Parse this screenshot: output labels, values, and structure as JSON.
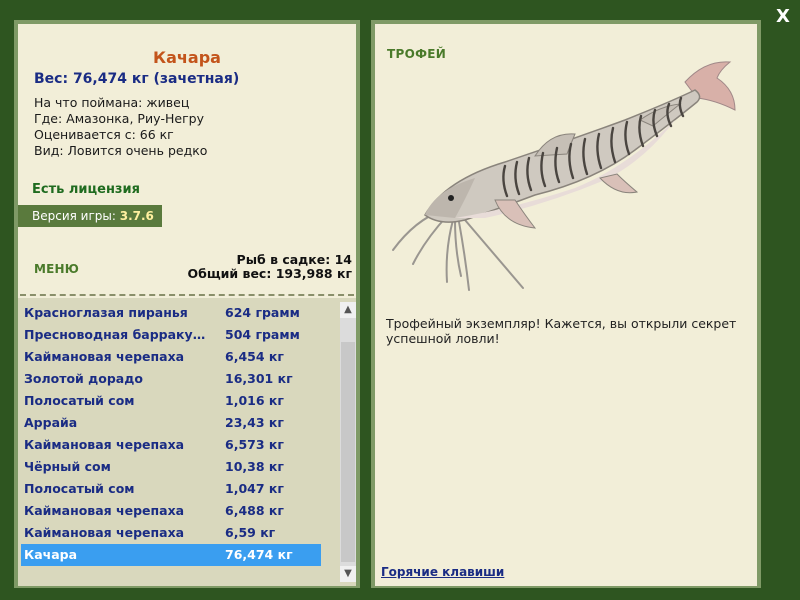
{
  "close_label": "X",
  "fish": {
    "name": "Качара",
    "weight_line": "Вес: 76,474 кг (зачетная)",
    "caught_with": "На что поймана: живец",
    "location": "Где: Амазонка, Риу-Негру",
    "valued_from": "Оценивается с: 66 кг",
    "kind": "Вид: Ловится очень редко"
  },
  "license": "Есть лицензия",
  "version": {
    "label": "Версия игры: ",
    "value": "3.7.6"
  },
  "menu_label": "МЕНЮ",
  "keepnet": {
    "count_line": "Рыб в садке: 14",
    "total_line": "Общий вес: 193,988 кг"
  },
  "catch_list": [
    {
      "name": "Красноглазая пиранья",
      "weight": "624 грамм"
    },
    {
      "name": "Пресноводная барраку…",
      "weight": "504 грамм"
    },
    {
      "name": "Каймановая черепаха",
      "weight": "6,454 кг"
    },
    {
      "name": "Золотой дорадо",
      "weight": "16,301 кг"
    },
    {
      "name": "Полосатый сом",
      "weight": "1,016 кг"
    },
    {
      "name": "Аррайа",
      "weight": "23,43 кг"
    },
    {
      "name": "Каймановая черепаха",
      "weight": "6,573 кг"
    },
    {
      "name": "Чёрный сом",
      "weight": "10,38 кг"
    },
    {
      "name": "Полосатый сом",
      "weight": "1,047 кг"
    },
    {
      "name": "Каймановая черепаха",
      "weight": "6,488 кг"
    },
    {
      "name": "Каймановая черепаха",
      "weight": "6,59 кг"
    },
    {
      "name": "Качара",
      "weight": "76,474 кг"
    }
  ],
  "selected_index": 11,
  "trophy": {
    "title": "ТРОФЕЙ",
    "text": "Трофейный экземпляр! Кажется, вы открыли секрет успешной ловли!"
  },
  "hotkeys_label": "Горячие клавиши",
  "colors": {
    "background": "#2e5520",
    "panel": "#f2eed8",
    "fish_title": "#c3541b",
    "link_blue": "#1a2c84",
    "selected_row": "#3a9ef0"
  },
  "icons": [
    "close-icon",
    "scroll-up-icon",
    "scroll-down-icon",
    "fish-illustration"
  ]
}
